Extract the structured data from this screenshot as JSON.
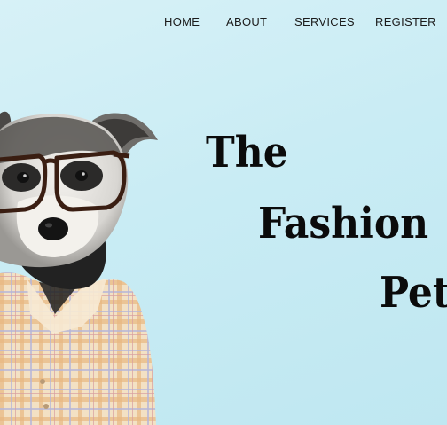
{
  "nav": {
    "home": "HOME",
    "about": "ABOUT",
    "services": "SERVICES",
    "register": "REGISTER"
  },
  "hero": {
    "title_words": [
      "The",
      "Fashion",
      "Pet"
    ],
    "image": {
      "description_icon": "dog-with-glasses-and-plaid-shirt"
    }
  },
  "colors": {
    "background": "#c9ecf4",
    "text": "#0b0b0b",
    "nav_text": "#1b1b1b"
  }
}
